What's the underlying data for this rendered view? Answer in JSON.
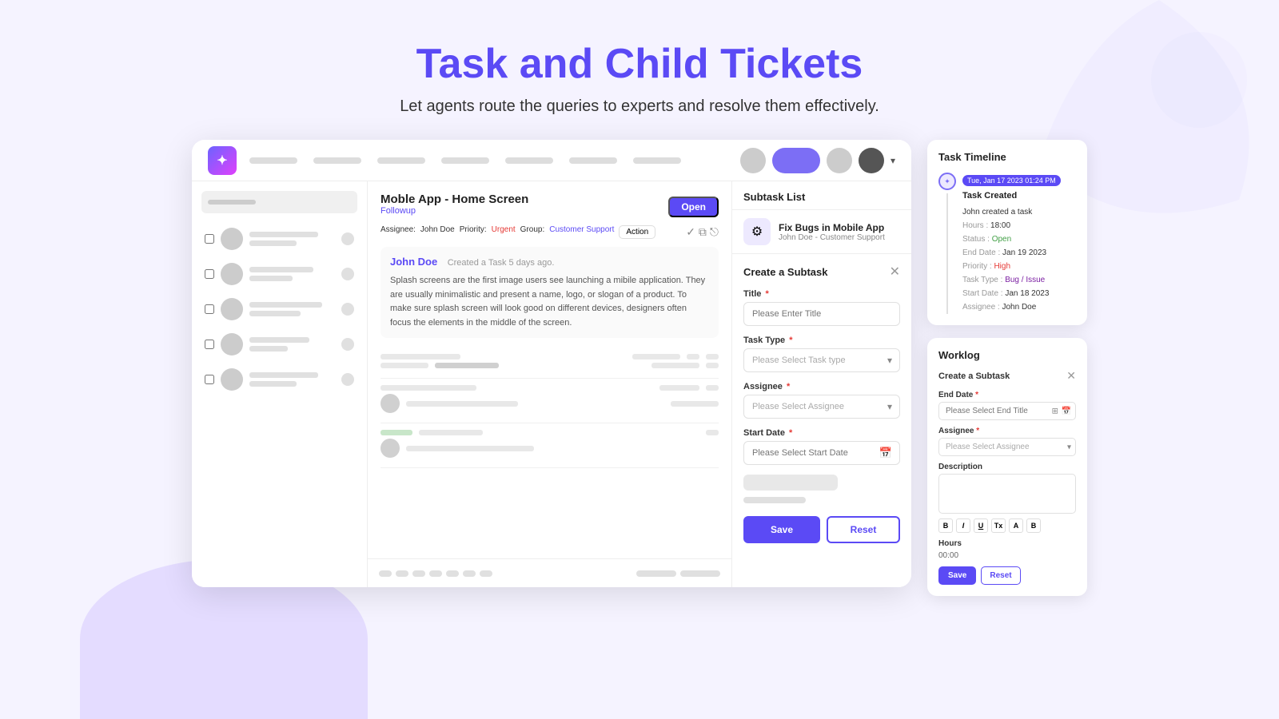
{
  "page": {
    "title": "Task and Child Tickets",
    "subtitle": "Let agents route the queries to experts and resolve them effectively."
  },
  "navbar": {
    "logo": "✦",
    "nav_items_count": 7,
    "avatar_colors": [
      "#ccc",
      "#7c6ef5",
      "#ccc",
      "#555"
    ]
  },
  "ticket": {
    "title": "Moble App - Home Screen",
    "status": "Open",
    "tag": "Followup",
    "assignee_label": "Assignee:",
    "assignee": "John Doe",
    "priority_label": "Priority:",
    "priority": "Urgent",
    "group_label": "Group:",
    "group": "Customer Support",
    "action_btn": "Action",
    "author": "John Doe",
    "message_time": "Created a Task 5 days ago.",
    "message_body": "Splash screens are the first image users see launching a mibile application. They are usually minimalistic and present a name, logo, or slogan of a product. To make sure splash screen will look good on different devices, designers often focus the elements in the middle of the screen."
  },
  "subtask_list": {
    "header": "Subtask List",
    "items": [
      {
        "name": "Fix Bugs in Mobile App",
        "team": "John Doe - Customer Support",
        "icon": "⚙"
      }
    ]
  },
  "create_subtask": {
    "header": "Create a Subtask",
    "title_label": "Title",
    "title_placeholder": "Please Enter Title",
    "task_type_label": "Task Type",
    "task_type_placeholder": "Please Select Task type",
    "assignee_label": "Assignee",
    "assignee_placeholder": "Please Select Assignee",
    "start_date_label": "Start Date",
    "start_date_placeholder": "Please Select Start Date",
    "save_btn": "Save",
    "reset_btn": "Reset"
  },
  "task_timeline": {
    "header": "Task Timeline",
    "date_badge": "Tue, Jan 17 2023  01:24 PM",
    "event_title": "Task Created",
    "details": {
      "created_by_label": "John created a task",
      "hours_label": "Hours :",
      "hours_value": "18:00",
      "status_label": "Status :",
      "status_value": "Open",
      "end_date_label": "End Date :",
      "end_date_value": "Jan 19 2023",
      "priority_label": "Priority :",
      "priority_value": "High",
      "task_type_label": "Task Type :",
      "task_type_value": "Bug / Issue",
      "start_date_label": "Start Date :",
      "start_date_value": "Jan 18 2023",
      "assignee_label": "Assignee :",
      "assignee_value": "John Doe"
    }
  },
  "worklog": {
    "header": "Worklog",
    "form_title": "Create a Subtask",
    "end_date_label": "End Date",
    "end_date_placeholder": "Please Select End Title",
    "assignee_label": "Assignee",
    "assignee_placeholder": "Please Select Assignee",
    "description_label": "Description",
    "toolbar": [
      "B",
      "I",
      "U",
      "Tx",
      "A",
      "B"
    ],
    "hours_label": "Hours",
    "hours_value": "00:00",
    "save_btn": "Save",
    "reset_btn": "Reset"
  }
}
